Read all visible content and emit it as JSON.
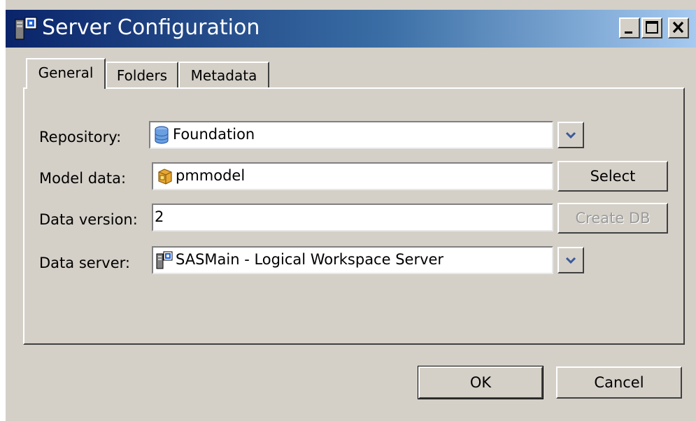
{
  "window": {
    "title": "Server Configuration",
    "app_icon": "server-config-icon",
    "controls": {
      "minimize": "minimize-icon",
      "maximize": "maximize-icon",
      "close": "close-icon"
    }
  },
  "tabs": [
    {
      "label": "General",
      "active": true
    },
    {
      "label": "Folders",
      "active": false
    },
    {
      "label": "Metadata",
      "active": false
    }
  ],
  "form": {
    "repository": {
      "label": "Repository:",
      "value": "Foundation",
      "icon": "database-icon"
    },
    "model_data": {
      "label": "Model data:",
      "value": "pmmodel",
      "icon": "package-icon",
      "button": "Select"
    },
    "data_version": {
      "label": "Data version:",
      "value": "2",
      "button": "Create DB",
      "button_disabled": true
    },
    "data_server": {
      "label": "Data server:",
      "value": "SASMain - Logical Workspace Server",
      "icon": "server-icon"
    }
  },
  "footer": {
    "ok": "OK",
    "cancel": "Cancel"
  },
  "colors": {
    "face": "#d4d0c8",
    "title_start": "#0a246a",
    "title_end": "#a6caf0",
    "disabled_text": "#9a9a9a"
  }
}
